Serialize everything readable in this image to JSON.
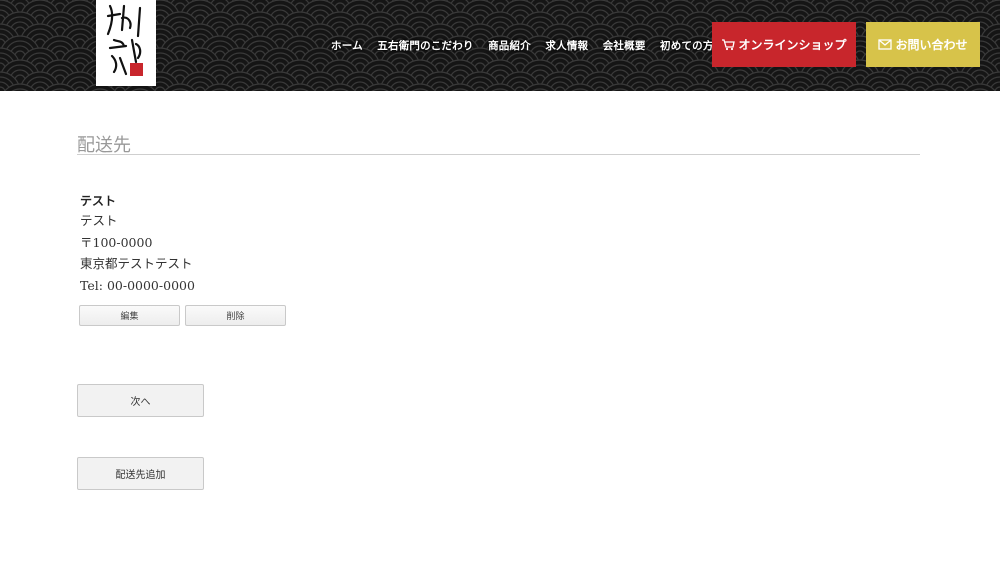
{
  "header": {
    "logo_text": "丹波大山五右衛門",
    "nav": [
      "ホーム",
      "五右衛門のこだわり",
      "商品紹介",
      "求人情報",
      "会社概要",
      "初めての方へ"
    ],
    "shop_label": "オンラインショップ",
    "contact_label": "お問い合わせ",
    "shop_color": "#c8262c",
    "contact_color": "#d7c34a",
    "icons": {
      "shop": "cart-icon",
      "contact": "mail-icon"
    }
  },
  "main": {
    "section_title": "配送先",
    "address": {
      "name": "テスト",
      "lines": [
        "テスト",
        "〒100-0000",
        "東京都テストテスト",
        "Tel: 00-0000-0000"
      ]
    },
    "edit_label": "編集",
    "delete_label": "削除",
    "next_label": "次へ",
    "add_label": "配送先追加"
  }
}
